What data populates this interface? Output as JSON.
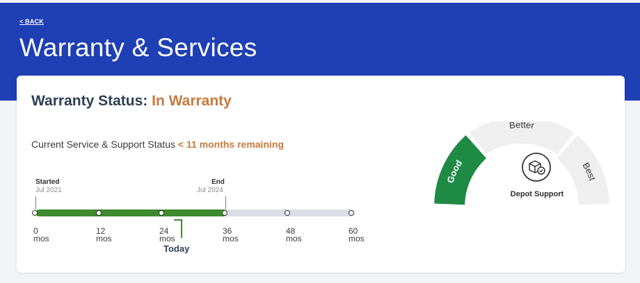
{
  "header": {
    "back_label": "< BACK",
    "title": "Warranty & Services",
    "background": "#1f3fb4"
  },
  "warranty": {
    "status_prefix": "Warranty Status:",
    "status_value": "In Warranty",
    "status_color": "#c8783d",
    "service_label": "Current Service & Support Status",
    "remaining": "< 11 months remaining"
  },
  "timeline": {
    "start_title": "Started",
    "start_date": "Jul 2021",
    "end_title": "End",
    "end_date": "Jul 2024",
    "today_label": "Today",
    "fill_fraction": 0.6,
    "ticks": [
      {
        "value": "0",
        "unit": "mos"
      },
      {
        "value": "12",
        "unit": "mos"
      },
      {
        "value": "24",
        "unit": "mos"
      },
      {
        "value": "36",
        "unit": "mos"
      },
      {
        "value": "48",
        "unit": "mos"
      },
      {
        "value": "60",
        "unit": "mos"
      }
    ],
    "fill_color": "#3e8a2e"
  },
  "gauge": {
    "levels": [
      "Good",
      "Better",
      "Best"
    ],
    "active_level": "Good",
    "active_color": "#1e8a44",
    "center_icon": "package-support-icon",
    "center_label": "Depot Support"
  }
}
